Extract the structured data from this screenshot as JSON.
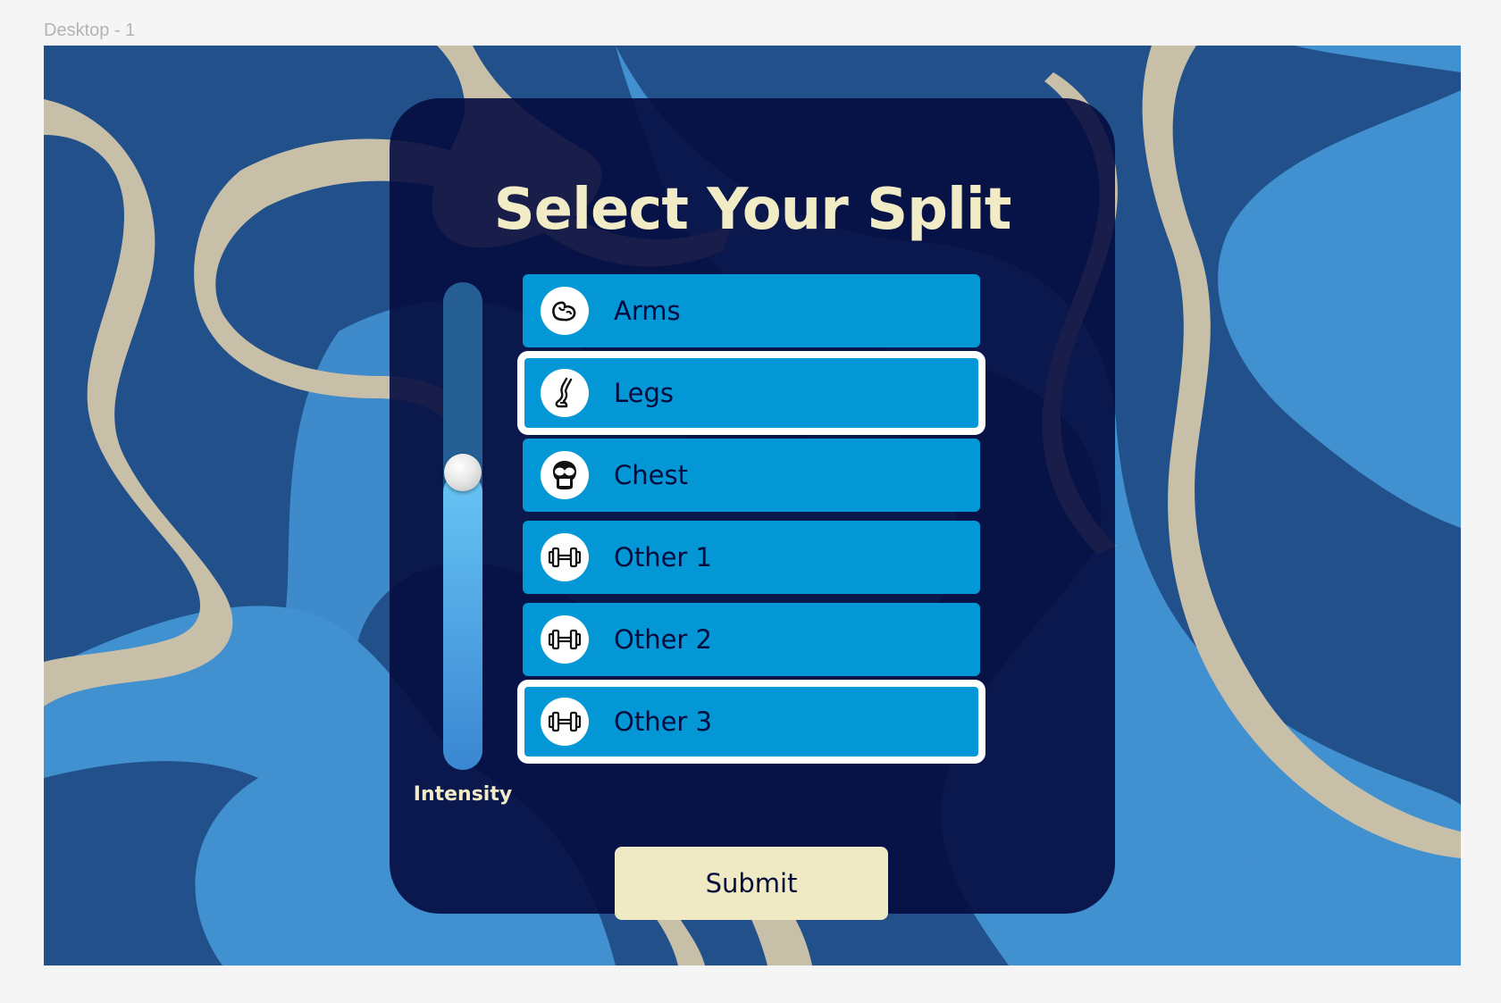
{
  "frame": {
    "label": "Desktop - 1"
  },
  "form": {
    "title": "Select Your Split",
    "intensity": {
      "label": "Intensity",
      "value": 0.61
    },
    "options": [
      {
        "label": "Arms",
        "icon": "flexed-arm-icon",
        "selected": false
      },
      {
        "label": "Legs",
        "icon": "leg-icon",
        "selected": true
      },
      {
        "label": "Chest",
        "icon": "chest-icon",
        "selected": false
      },
      {
        "label": "Other 1",
        "icon": "dumbbell-icon",
        "selected": false
      },
      {
        "label": "Other 2",
        "icon": "dumbbell-icon",
        "selected": false
      },
      {
        "label": "Other 3",
        "icon": "dumbbell-icon",
        "selected": true
      }
    ],
    "submit_label": "Submit"
  },
  "colors": {
    "background": "#22508a",
    "accent_blue": "#0497d6",
    "card": "#040b3e",
    "cream": "#f1ecc5",
    "sand": "#c8bfa9",
    "light_blue": "#4190d0"
  }
}
